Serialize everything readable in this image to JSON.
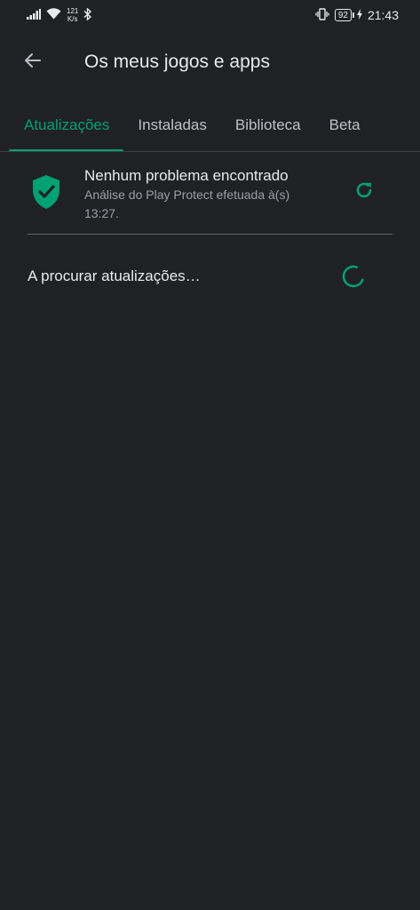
{
  "status_bar": {
    "net_speed_value": "121",
    "net_speed_unit": "K/s",
    "battery": "92",
    "time": "21:43"
  },
  "app_bar": {
    "title": "Os meus jogos e apps",
    "back_icon": "arrow-left-icon"
  },
  "tabs": [
    {
      "label": "Atualizações",
      "active": true
    },
    {
      "label": "Instaladas",
      "active": false
    },
    {
      "label": "Biblioteca",
      "active": false
    },
    {
      "label": "Beta",
      "active": false
    }
  ],
  "play_protect": {
    "title": "Nenhum problema encontrado",
    "subtitle_line1": "Análise do Play Protect efetuada à(s)",
    "subtitle_line2": "13:27.",
    "icon": "shield-check-icon",
    "refresh_icon": "refresh-icon"
  },
  "updates": {
    "checking_label": "A procurar atualizações…",
    "spinner_icon": "loading-spinner-icon"
  },
  "colors": {
    "background": "#202124",
    "accent": "#00a173",
    "text_primary": "#e8eaed",
    "text_secondary": "#9aa0a6",
    "divider": "#5f6368"
  }
}
